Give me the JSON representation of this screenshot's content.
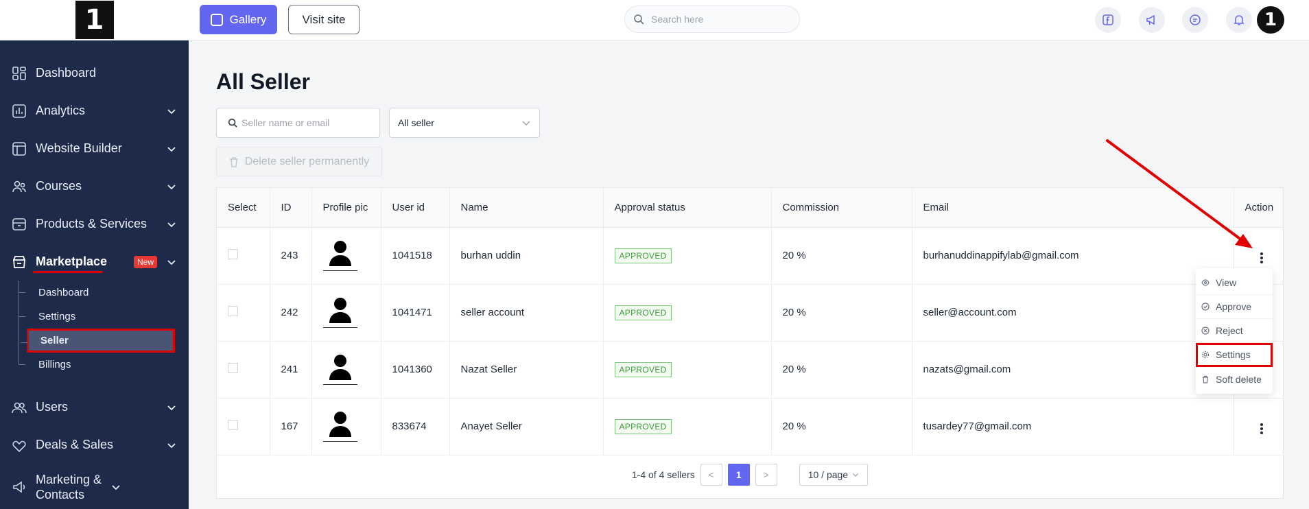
{
  "sidebar": {
    "logo": "1",
    "items": [
      {
        "label": "Dashboard",
        "icon": "dashboard-icon"
      },
      {
        "label": "Analytics",
        "icon": "analytics-icon"
      },
      {
        "label": "Website Builder",
        "icon": "website-builder-icon"
      },
      {
        "label": "Courses",
        "icon": "courses-icon"
      },
      {
        "label": "Products & Services",
        "icon": "products-icon"
      },
      {
        "label": "Marketplace",
        "icon": "marketplace-icon",
        "badge": "New"
      }
    ],
    "marketplace_sub": [
      "Dashboard",
      "Settings",
      "Seller",
      "Billings"
    ],
    "items2": [
      {
        "label": "Users",
        "icon": "users-icon"
      },
      {
        "label": "Deals & Sales",
        "icon": "deals-icon"
      },
      {
        "label": "Marketing & Contacts",
        "icon": "marketing-icon"
      }
    ]
  },
  "topbar": {
    "gallery_label": "Gallery",
    "visit_label": "Visit site",
    "search_placeholder": "Search here",
    "avatar": "1"
  },
  "page": {
    "title": "All Seller",
    "search_placeholder": "Seller name or email",
    "filter_selected": "All seller",
    "delete_label": "Delete seller permanently"
  },
  "table": {
    "columns": [
      "Select",
      "ID",
      "Profile pic",
      "User id",
      "Name",
      "Approval status",
      "Commission",
      "Email",
      "Action"
    ],
    "rows": [
      {
        "id": "243",
        "user_id": "1041518",
        "name": "burhan uddin",
        "status": "APPROVED",
        "commission": "20 %",
        "email": "burhanuddinappifylab@gmail.com"
      },
      {
        "id": "242",
        "user_id": "1041471",
        "name": "seller account",
        "status": "APPROVED",
        "commission": "20 %",
        "email": "seller@account.com"
      },
      {
        "id": "241",
        "user_id": "1041360",
        "name": "Nazat Seller",
        "status": "APPROVED",
        "commission": "20 %",
        "email": "nazats@gmail.com"
      },
      {
        "id": "167",
        "user_id": "833674",
        "name": "Anayet Seller",
        "status": "APPROVED",
        "commission": "20 %",
        "email": "tusardey77@gmail.com"
      }
    ]
  },
  "pagination": {
    "summary": "1-4 of 4 sellers",
    "prev": "<",
    "current": "1",
    "next": ">",
    "per_page": "10 / page"
  },
  "action_menu": {
    "items": [
      "View",
      "Approve",
      "Reject",
      "Settings",
      "Soft delete"
    ]
  },
  "colors": {
    "accent": "#6366f1",
    "sidebar_bg": "#1e2a4a",
    "highlight": "#e00000",
    "approved": "#3c9a3c"
  }
}
